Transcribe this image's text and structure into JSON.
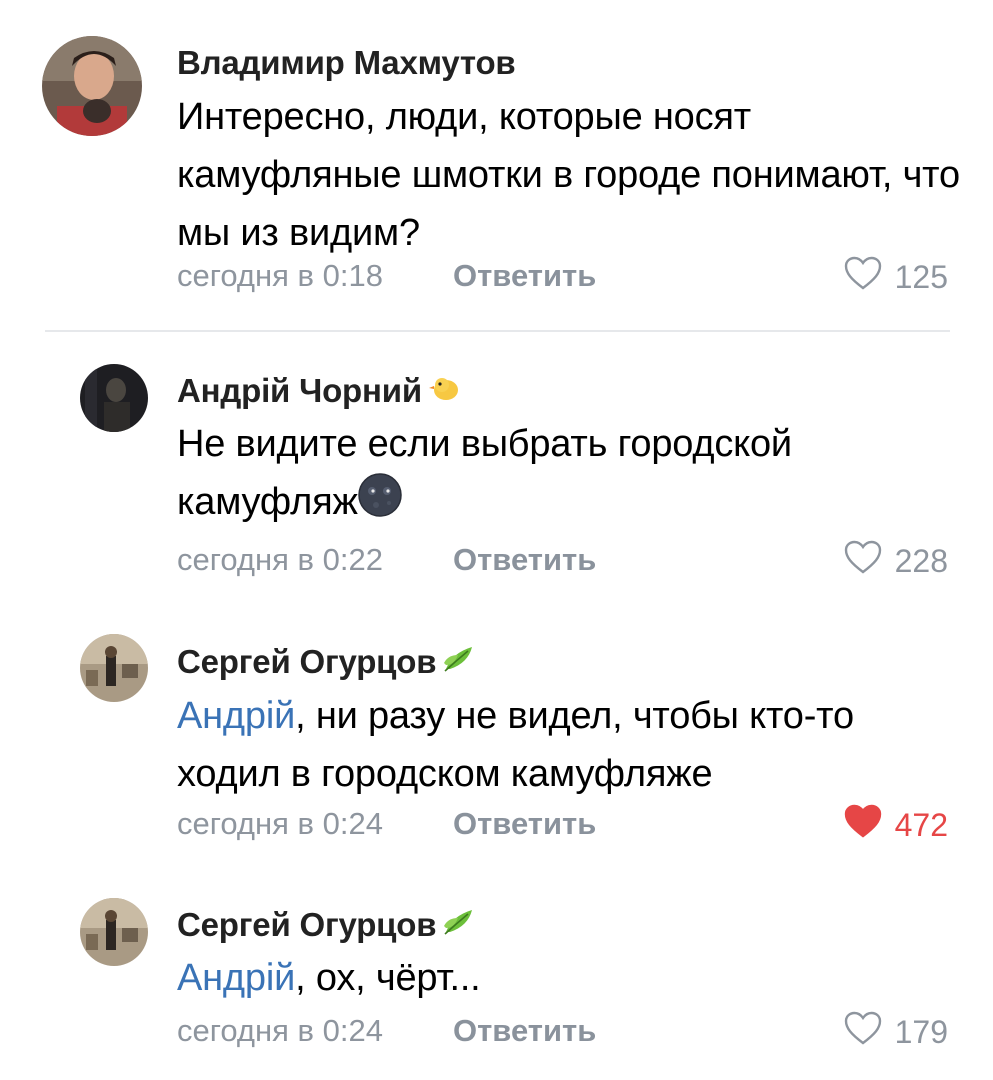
{
  "comments": [
    {
      "author": "Владимир Махмутов",
      "text": "Интересно, люди, которые носят камуфляные шмотки в городе понимают, что мы из видим?",
      "time": "сегодня в 0:18",
      "reply_label": "Ответить",
      "likes": "125",
      "liked": false
    },
    {
      "author": "Андрій Чорний",
      "badge": "chick-emoji",
      "text": "Не видите если выбрать городской камуфляж",
      "text_emoji": "new-moon-face-emoji",
      "time": "сегодня в 0:22",
      "reply_label": "Ответить",
      "likes": "228",
      "liked": false
    },
    {
      "author": "Сергей Огурцов",
      "badge": "leaf-emoji",
      "mention": "Андрій",
      "text": ", ни разу не видел, чтобы кто-то ходил в городском камуфляже",
      "time": "сегодня в 0:24",
      "reply_label": "Ответить",
      "likes": "472",
      "liked": true
    },
    {
      "author": "Сергей Огурцов",
      "badge": "leaf-emoji",
      "mention": "Андрій",
      "text": ", ох, чёрт...",
      "time": "сегодня в 0:24",
      "reply_label": "Ответить",
      "likes": "179",
      "liked": false
    }
  ],
  "colors": {
    "like_active": "#e64646",
    "mention": "#3a73b6",
    "meta": "#8e959e"
  }
}
